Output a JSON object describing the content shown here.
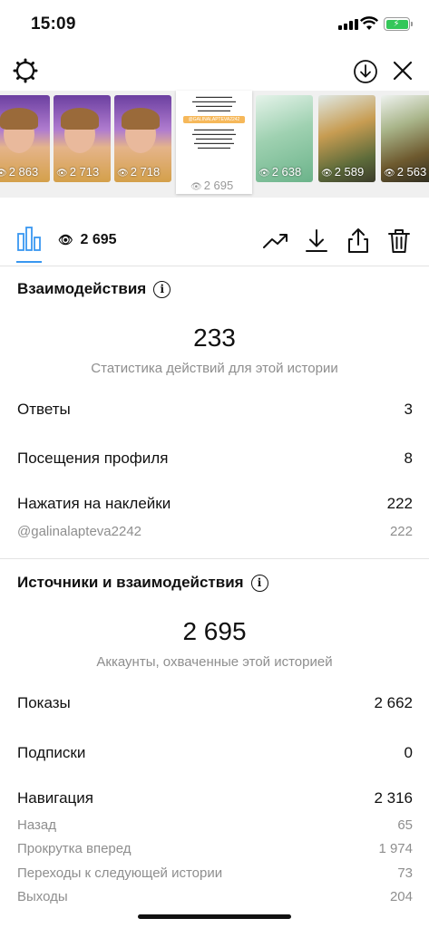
{
  "status_bar": {
    "time": "15:09"
  },
  "stories": [
    {
      "views": "2 863",
      "kind": "face"
    },
    {
      "views": "2 713",
      "kind": "face"
    },
    {
      "views": "2 718",
      "kind": "face"
    },
    {
      "views": "2 695",
      "kind": "text",
      "selected": true
    },
    {
      "views": "2 638",
      "kind": "green"
    },
    {
      "views": "2 589",
      "kind": "food"
    },
    {
      "views": "2 563",
      "kind": "food2"
    }
  ],
  "selected_story": {
    "handle": "@GALINALAPTEVA2242"
  },
  "tabs": {
    "views_count": "2 695"
  },
  "interactions": {
    "title": "Взаимодействия",
    "total": "233",
    "subtitle": "Статистика действий для этой истории",
    "rows": [
      {
        "label": "Ответы",
        "value": "3"
      },
      {
        "label": "Посещения профиля",
        "value": "8"
      },
      {
        "label": "Нажатия на наклейки",
        "value": "222"
      }
    ],
    "sticker": {
      "label": "@galinalapteva2242",
      "value": "222"
    }
  },
  "sources": {
    "title": "Источники и взаимодействия",
    "total": "2 695",
    "subtitle": "Аккаунты, охваченные этой историей",
    "rows": [
      {
        "label": "Показы",
        "value": "2 662"
      },
      {
        "label": "Подписки",
        "value": "0"
      },
      {
        "label": "Навигация",
        "value": "2 316"
      }
    ],
    "navigation": [
      {
        "label": "Назад",
        "value": "65"
      },
      {
        "label": "Прокрутка вперед",
        "value": "1 974"
      },
      {
        "label": "Переходы к следующей истории",
        "value": "73"
      },
      {
        "label": "Выходы",
        "value": "204"
      }
    ]
  },
  "colors": {
    "accent": "#3897f0",
    "battery": "#34c759",
    "muted": "#8e8e8e"
  }
}
